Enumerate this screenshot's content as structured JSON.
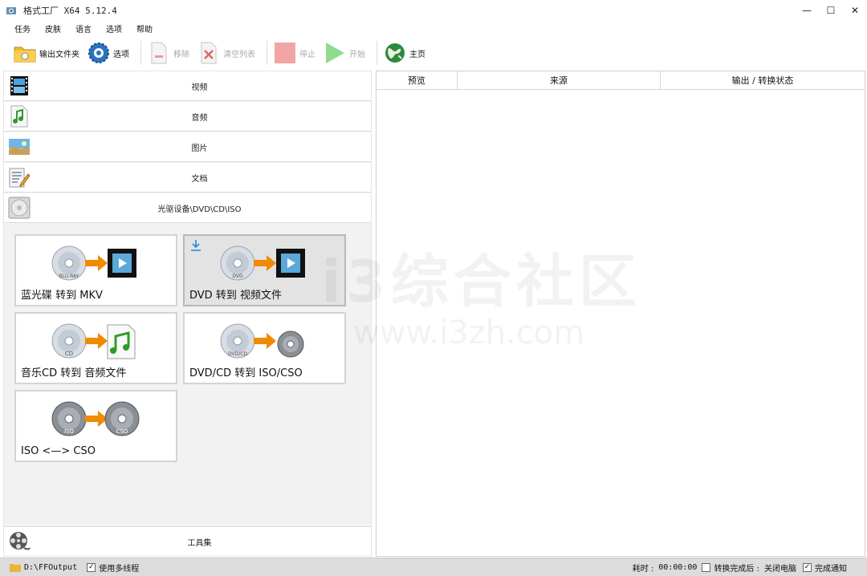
{
  "window": {
    "title": "格式工厂 X64 5.12.4",
    "minimize": "—",
    "maximize": "☐",
    "close": "✕"
  },
  "menu": [
    "任务",
    "皮肤",
    "语言",
    "选项",
    "帮助"
  ],
  "toolbar": {
    "output_folder": "输出文件夹",
    "options": "选项",
    "remove": "移除",
    "clear_list": "清空列表",
    "stop": "停止",
    "start": "开始",
    "home": "主页"
  },
  "categories": [
    {
      "label": "视频",
      "icon": "video-icon"
    },
    {
      "label": "音频",
      "icon": "audio-icon"
    },
    {
      "label": "图片",
      "icon": "picture-icon"
    },
    {
      "label": "文档",
      "icon": "document-icon"
    },
    {
      "label": "光驱设备\\DVD\\CD\\ISO",
      "icon": "disc-drive-icon"
    }
  ],
  "tiles": [
    {
      "label": "蓝光碟 转到 MKV",
      "disc_text": "BLU-RAY"
    },
    {
      "label": "DVD 转到 视频文件",
      "disc_text": "DVD"
    },
    {
      "label": "音乐CD 转到 音频文件",
      "disc_text": "CD"
    },
    {
      "label": "DVD/CD 转到 ISO/CSO",
      "disc_text": "DVD/CD"
    },
    {
      "label": "ISO <—> CSO",
      "disc_text": "ISO",
      "disc_text2": "CSO"
    }
  ],
  "toolset": {
    "label": "工具集"
  },
  "table": {
    "columns": [
      "预览",
      "来源",
      "输出 / 转换状态"
    ]
  },
  "watermark": {
    "line1": "i3综合社区",
    "line2": "www.i3zh.com"
  },
  "status": {
    "output_path": "D:\\FFOutput",
    "multithread_label": "使用多线程",
    "multithread_checked": true,
    "elapsed_label": "耗时 :",
    "elapsed_value": "00:00:00",
    "after_convert_label": "转换完成后 :",
    "after_convert_value": "关闭电脑",
    "after_convert_checked": false,
    "notify_label": "完成通知",
    "notify_checked": true
  },
  "colors": {
    "accent_orange": "#f08a00",
    "start_green": "#7ed67e",
    "stop_red": "#f2a5a5",
    "download_blue": "#1e88e5"
  }
}
